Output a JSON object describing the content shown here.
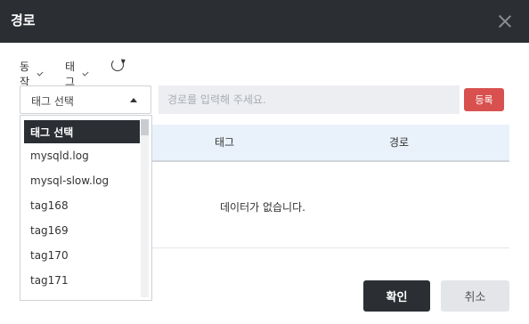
{
  "dialog": {
    "title": "경로"
  },
  "toolbar": {
    "action_label": "동작",
    "tag_label": "태그"
  },
  "tag_select": {
    "selected": "태그 선택",
    "options": [
      "태그 선택",
      "mysqld.log",
      "mysql-slow.log",
      "tag168",
      "tag169",
      "tag170",
      "tag171"
    ]
  },
  "path_input": {
    "placeholder": "경로를 입력해 주세요.",
    "value": ""
  },
  "register_label": "등록",
  "table": {
    "columns": [
      "태그",
      "경로"
    ],
    "empty_text": "데이터가 없습니다."
  },
  "footer": {
    "confirm_label": "확인",
    "cancel_label": "취소"
  },
  "colors": {
    "header_bg": "#2b2e33",
    "accent_red": "#d8514f",
    "table_head_bg": "#e9f2fb"
  }
}
